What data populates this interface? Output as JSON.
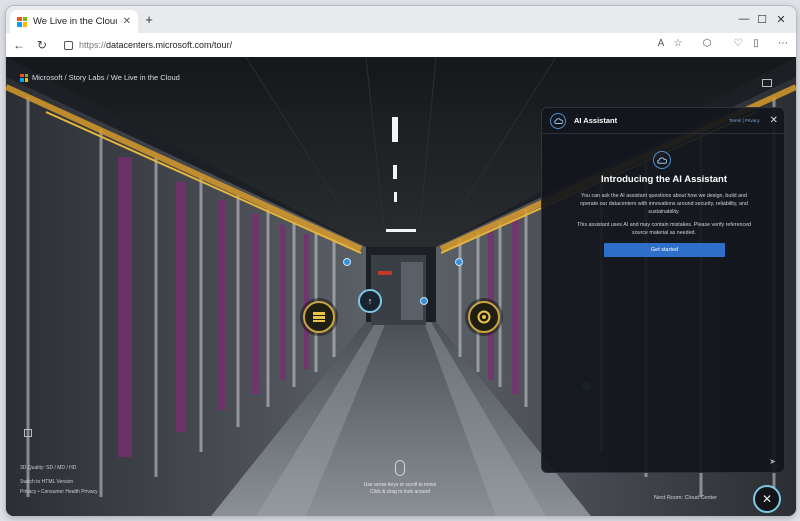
{
  "browser": {
    "tab_title": "We Live in the Cloud | Mi",
    "tab_close_icon": "close-icon",
    "new_tab_label": "+",
    "url_protocol": "https://",
    "url_rest": "datacenters.microsoft.com/tour/"
  },
  "site": {
    "breadcrumb": "Microsoft  /  Story Labs  /  We Live in the Cloud"
  },
  "ai_assistant": {
    "title": "AI Assistant",
    "links": "Terms  |  Privacy",
    "heading": "Introducing the AI Assistant",
    "body1": "You can ask the AI assistant questions about how we design, build and operate our datacenters with innovations around security, reliability, and sustainability.",
    "body2": "This assistant uses AI and may contain mistakes. Please verify referenced source material as needed.",
    "button": "Get started"
  },
  "hint": {
    "line1": "Use arrow keys or scroll to move",
    "line2": "Click & drag to look around"
  },
  "footer": {
    "quality": "3D Quality: SD / MD / HD",
    "switch": "Switch to HTML Version",
    "privacy": "Privacy  •  Consumer Health Privacy",
    "next": "Next Room: Cloud Center"
  },
  "colors": {
    "accent": "#2d6fc9",
    "hotspot_ring": "#caa53a",
    "close_ring": "#7cc8e6"
  }
}
